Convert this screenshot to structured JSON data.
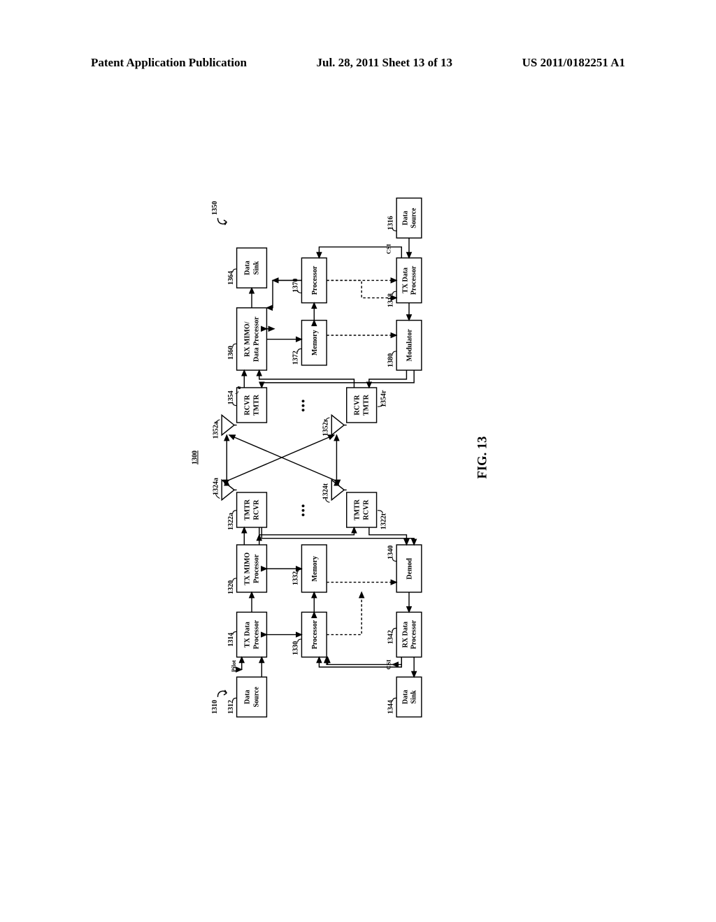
{
  "header": {
    "left": "Patent Application Publication",
    "center": "Jul. 28, 2011  Sheet 13 of 13",
    "right": "US 2011/0182251 A1"
  },
  "figure_caption": "FIG. 13",
  "diagram_number": "1300",
  "station_left_ref": "1310",
  "station_right_ref": "1350",
  "blocks": {
    "data_source_left": {
      "label1": "Data",
      "label2": "Source",
      "ref": "1312"
    },
    "tx_data_left": {
      "label1": "TX Data",
      "label2": "Processor",
      "ref": "1314"
    },
    "tx_mimo": {
      "label1": "TX MIMO",
      "label2": "Processor",
      "ref": "1320"
    },
    "tmtr_rcvr_a": {
      "label1": "TMTR",
      "label2": "RCVR",
      "ref": "1322a"
    },
    "tmtr_rcvr_t": {
      "label1": "TMTR",
      "label2": "RCVR",
      "ref": "1322t"
    },
    "antenna_left_a": {
      "ref": "1324a"
    },
    "antenna_left_t": {
      "ref": "1324t"
    },
    "antenna_right_a": {
      "ref": "1352a"
    },
    "antenna_right_r": {
      "ref": "1352r"
    },
    "rcvr_tmtr_a": {
      "label1": "RCVR",
      "label2": "TMTR",
      "ref": "1354"
    },
    "rcvr_tmtr_r": {
      "label1": "RCVR",
      "label2": "TMTR",
      "ref": "1354r"
    },
    "rx_mimo": {
      "label1": "RX MIMO/",
      "label2": "Data Processor",
      "ref": "1360"
    },
    "data_sink_right": {
      "label1": "Data",
      "label2": "Sink",
      "ref": "1364"
    },
    "processor_left": {
      "label": "Processor",
      "ref": "1330"
    },
    "memory_left": {
      "label": "Memory",
      "ref": "1332"
    },
    "processor_right": {
      "label": "Processor",
      "ref": "1370"
    },
    "memory_right": {
      "label": "Memory",
      "ref": "1372"
    },
    "demod": {
      "label": "Demod",
      "ref": "1340"
    },
    "rx_data_left": {
      "label1": "RX Data",
      "label2": "Processor",
      "ref": "1342"
    },
    "data_sink_left": {
      "label1": "Data",
      "label2": "Sink",
      "ref": "1344"
    },
    "modulator": {
      "label": "Modulator",
      "ref": "1380"
    },
    "tx_data_right": {
      "label1": "TX Data",
      "label2": "Processor",
      "ref": "1318"
    },
    "data_source_right": {
      "label1": "Data",
      "label2": "Source",
      "ref": "1316"
    }
  },
  "labels": {
    "pilot": "Pilot",
    "csi": "CSI",
    "a_suffix": "a",
    "ellipsis_left": "•••",
    "ellipsis_right": "•••"
  }
}
